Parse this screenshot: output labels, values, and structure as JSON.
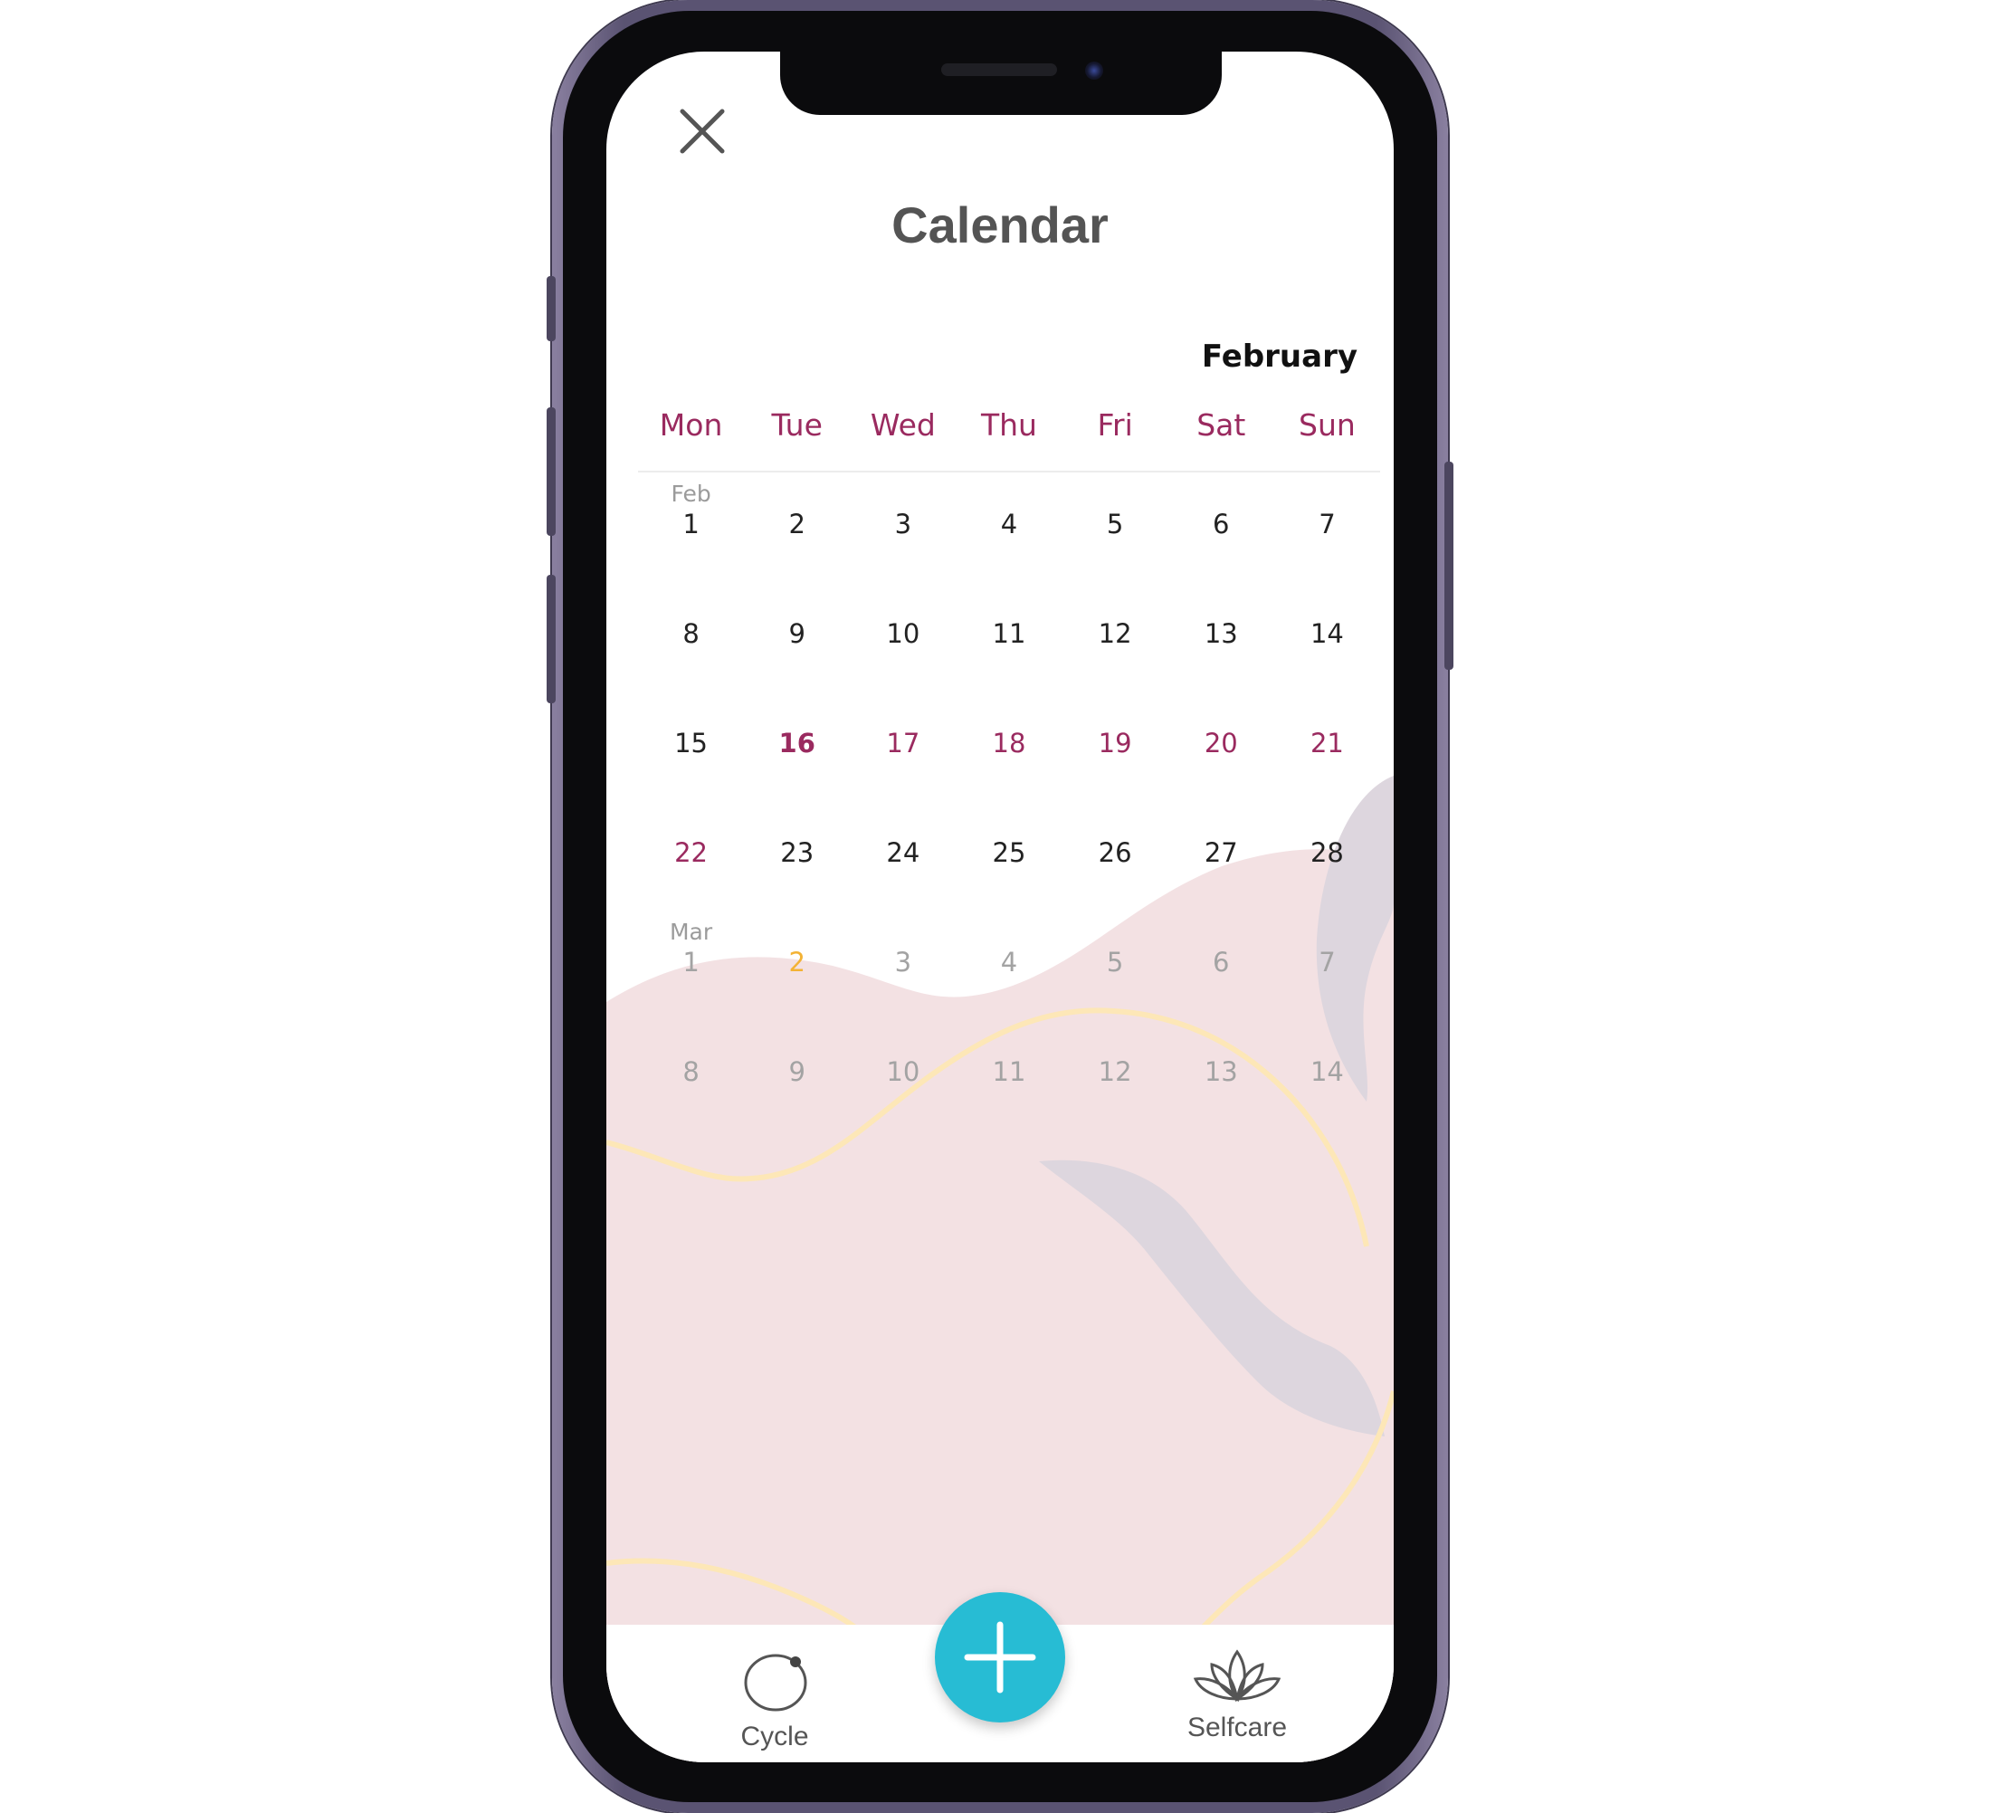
{
  "header": {
    "title": "Calendar",
    "close_icon": "close-icon"
  },
  "calendar": {
    "month_label": "February",
    "weekdays": [
      "Mon",
      "Tue",
      "Wed",
      "Thu",
      "Fri",
      "Sat",
      "Sun"
    ],
    "weeks": [
      [
        {
          "day": "1",
          "month_label": "Feb",
          "type": "normal"
        },
        {
          "day": "2",
          "type": "normal"
        },
        {
          "day": "3",
          "type": "normal"
        },
        {
          "day": "4",
          "type": "normal"
        },
        {
          "day": "5",
          "type": "normal"
        },
        {
          "day": "6",
          "type": "normal"
        },
        {
          "day": "7",
          "type": "normal"
        }
      ],
      [
        {
          "day": "8",
          "type": "normal"
        },
        {
          "day": "9",
          "type": "normal"
        },
        {
          "day": "10",
          "type": "normal"
        },
        {
          "day": "11",
          "type": "normal"
        },
        {
          "day": "12",
          "type": "normal"
        },
        {
          "day": "13",
          "type": "normal"
        },
        {
          "day": "14",
          "type": "normal"
        }
      ],
      [
        {
          "day": "15",
          "type": "normal"
        },
        {
          "day": "16",
          "type": "today"
        },
        {
          "day": "17",
          "type": "period"
        },
        {
          "day": "18",
          "type": "period"
        },
        {
          "day": "19",
          "type": "period"
        },
        {
          "day": "20",
          "type": "period"
        },
        {
          "day": "21",
          "type": "period"
        }
      ],
      [
        {
          "day": "22",
          "type": "period"
        },
        {
          "day": "23",
          "type": "normal"
        },
        {
          "day": "24",
          "type": "normal"
        },
        {
          "day": "25",
          "type": "normal"
        },
        {
          "day": "26",
          "type": "normal"
        },
        {
          "day": "27",
          "type": "normal"
        },
        {
          "day": "28",
          "type": "normal"
        }
      ],
      [
        {
          "day": "1",
          "month_label": "Mar",
          "type": "future"
        },
        {
          "day": "2",
          "type": "ovulation"
        },
        {
          "day": "3",
          "type": "future"
        },
        {
          "day": "4",
          "type": "future"
        },
        {
          "day": "5",
          "type": "future"
        },
        {
          "day": "6",
          "type": "future"
        },
        {
          "day": "7",
          "type": "future"
        }
      ],
      [
        {
          "day": "8",
          "type": "future"
        },
        {
          "day": "9",
          "type": "future"
        },
        {
          "day": "10",
          "type": "future"
        },
        {
          "day": "11",
          "type": "future"
        },
        {
          "day": "12",
          "type": "future"
        },
        {
          "day": "13",
          "type": "future"
        },
        {
          "day": "14",
          "type": "future"
        }
      ]
    ]
  },
  "tabbar": {
    "cycle_label": "Cycle",
    "cycle_icon": "cycle-icon",
    "add_icon": "plus-icon",
    "selfcare_label": "Selfcare",
    "selfcare_icon": "lotus-icon"
  },
  "colors": {
    "accent_period": "#9a2a5f",
    "ovulation": "#f3b234",
    "future_day": "#a3a3a3",
    "fab": "#27bcd4",
    "deco_pink": "#f3e1e3",
    "deco_leaf": "#ddd6de",
    "deco_line": "#fde7b7"
  }
}
